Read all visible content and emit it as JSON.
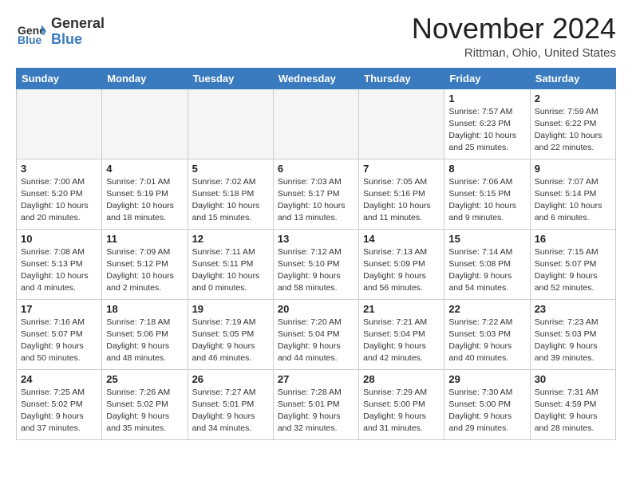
{
  "header": {
    "logo_general": "General",
    "logo_blue": "Blue",
    "month_title": "November 2024",
    "location": "Rittman, Ohio, United States"
  },
  "weekdays": [
    "Sunday",
    "Monday",
    "Tuesday",
    "Wednesday",
    "Thursday",
    "Friday",
    "Saturday"
  ],
  "weeks": [
    [
      {
        "day": "",
        "empty": true
      },
      {
        "day": "",
        "empty": true
      },
      {
        "day": "",
        "empty": true
      },
      {
        "day": "",
        "empty": true
      },
      {
        "day": "",
        "empty": true
      },
      {
        "day": "1",
        "sunrise": "7:57 AM",
        "sunset": "6:23 PM",
        "daylight": "10 hours and 25 minutes."
      },
      {
        "day": "2",
        "sunrise": "7:59 AM",
        "sunset": "6:22 PM",
        "daylight": "10 hours and 22 minutes."
      }
    ],
    [
      {
        "day": "3",
        "sunrise": "7:00 AM",
        "sunset": "5:20 PM",
        "daylight": "10 hours and 20 minutes."
      },
      {
        "day": "4",
        "sunrise": "7:01 AM",
        "sunset": "5:19 PM",
        "daylight": "10 hours and 18 minutes."
      },
      {
        "day": "5",
        "sunrise": "7:02 AM",
        "sunset": "5:18 PM",
        "daylight": "10 hours and 15 minutes."
      },
      {
        "day": "6",
        "sunrise": "7:03 AM",
        "sunset": "5:17 PM",
        "daylight": "10 hours and 13 minutes."
      },
      {
        "day": "7",
        "sunrise": "7:05 AM",
        "sunset": "5:16 PM",
        "daylight": "10 hours and 11 minutes."
      },
      {
        "day": "8",
        "sunrise": "7:06 AM",
        "sunset": "5:15 PM",
        "daylight": "10 hours and 9 minutes."
      },
      {
        "day": "9",
        "sunrise": "7:07 AM",
        "sunset": "5:14 PM",
        "daylight": "10 hours and 6 minutes."
      }
    ],
    [
      {
        "day": "10",
        "sunrise": "7:08 AM",
        "sunset": "5:13 PM",
        "daylight": "10 hours and 4 minutes."
      },
      {
        "day": "11",
        "sunrise": "7:09 AM",
        "sunset": "5:12 PM",
        "daylight": "10 hours and 2 minutes."
      },
      {
        "day": "12",
        "sunrise": "7:11 AM",
        "sunset": "5:11 PM",
        "daylight": "10 hours and 0 minutes."
      },
      {
        "day": "13",
        "sunrise": "7:12 AM",
        "sunset": "5:10 PM",
        "daylight": "9 hours and 58 minutes."
      },
      {
        "day": "14",
        "sunrise": "7:13 AM",
        "sunset": "5:09 PM",
        "daylight": "9 hours and 56 minutes."
      },
      {
        "day": "15",
        "sunrise": "7:14 AM",
        "sunset": "5:08 PM",
        "daylight": "9 hours and 54 minutes."
      },
      {
        "day": "16",
        "sunrise": "7:15 AM",
        "sunset": "5:07 PM",
        "daylight": "9 hours and 52 minutes."
      }
    ],
    [
      {
        "day": "17",
        "sunrise": "7:16 AM",
        "sunset": "5:07 PM",
        "daylight": "9 hours and 50 minutes."
      },
      {
        "day": "18",
        "sunrise": "7:18 AM",
        "sunset": "5:06 PM",
        "daylight": "9 hours and 48 minutes."
      },
      {
        "day": "19",
        "sunrise": "7:19 AM",
        "sunset": "5:05 PM",
        "daylight": "9 hours and 46 minutes."
      },
      {
        "day": "20",
        "sunrise": "7:20 AM",
        "sunset": "5:04 PM",
        "daylight": "9 hours and 44 minutes."
      },
      {
        "day": "21",
        "sunrise": "7:21 AM",
        "sunset": "5:04 PM",
        "daylight": "9 hours and 42 minutes."
      },
      {
        "day": "22",
        "sunrise": "7:22 AM",
        "sunset": "5:03 PM",
        "daylight": "9 hours and 40 minutes."
      },
      {
        "day": "23",
        "sunrise": "7:23 AM",
        "sunset": "5:03 PM",
        "daylight": "9 hours and 39 minutes."
      }
    ],
    [
      {
        "day": "24",
        "sunrise": "7:25 AM",
        "sunset": "5:02 PM",
        "daylight": "9 hours and 37 minutes."
      },
      {
        "day": "25",
        "sunrise": "7:26 AM",
        "sunset": "5:02 PM",
        "daylight": "9 hours and 35 minutes."
      },
      {
        "day": "26",
        "sunrise": "7:27 AM",
        "sunset": "5:01 PM",
        "daylight": "9 hours and 34 minutes."
      },
      {
        "day": "27",
        "sunrise": "7:28 AM",
        "sunset": "5:01 PM",
        "daylight": "9 hours and 32 minutes."
      },
      {
        "day": "28",
        "sunrise": "7:29 AM",
        "sunset": "5:00 PM",
        "daylight": "9 hours and 31 minutes."
      },
      {
        "day": "29",
        "sunrise": "7:30 AM",
        "sunset": "5:00 PM",
        "daylight": "9 hours and 29 minutes."
      },
      {
        "day": "30",
        "sunrise": "7:31 AM",
        "sunset": "4:59 PM",
        "daylight": "9 hours and 28 minutes."
      }
    ]
  ]
}
